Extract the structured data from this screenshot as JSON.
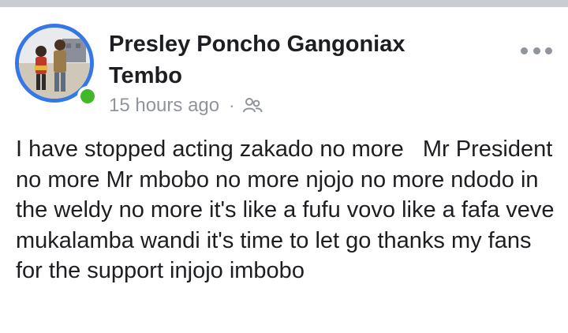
{
  "post": {
    "author_name": "Presley Poncho Gangoniax Tembo",
    "timestamp": "15 hours ago",
    "separator": "·",
    "privacy_icon": "friends-icon",
    "more_icon": "more-options-icon",
    "online_status": true,
    "body_text": "I have stopped acting zakado no more   Mr President no more Mr mbobo no more njojo no more ndodo in the weldy no more it's like a fufu vovo like a fafa veve mukalamba wandi it's time to let go thanks my fans for the support injojo imbobo"
  },
  "colors": {
    "avatar_ring": "#3578e5",
    "online_dot": "#42b72a",
    "meta_text": "#90949c",
    "body_text": "#1c1e21",
    "top_bar": "#c9ccd1"
  }
}
